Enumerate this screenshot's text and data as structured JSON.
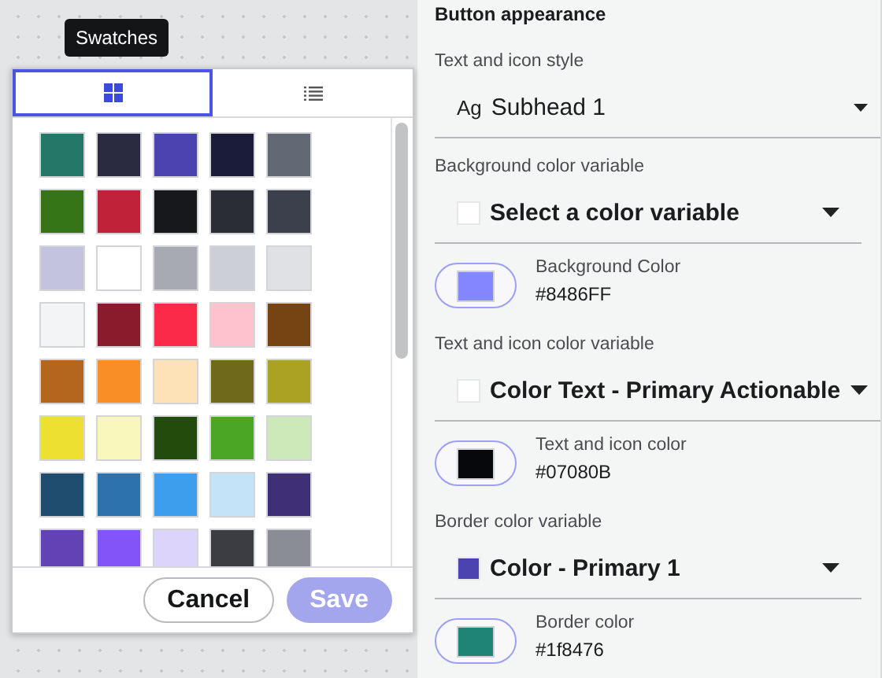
{
  "tooltip": "Swatches",
  "tabs": [
    {
      "kind": "grid",
      "selected": true
    },
    {
      "kind": "list",
      "selected": false
    }
  ],
  "swatches": [
    {
      "color": "#237868"
    },
    {
      "color": "#2a2a40"
    },
    {
      "color": "#4b44b0"
    },
    {
      "color": "#1b1b3a"
    },
    {
      "color": "#636875"
    },
    {
      "color": "#367517"
    },
    {
      "color": "#c0223a"
    },
    {
      "color": "#16181c"
    },
    {
      "color": "#2a2d35"
    },
    {
      "color": "#3c404c"
    },
    {
      "color": "#c3c3e0"
    },
    {
      "color": "#ffffff"
    },
    {
      "color": "#a7aab3"
    },
    {
      "color": "#cccfd6"
    },
    {
      "color": "#e0e1e5"
    },
    {
      "color": "#f3f4f6"
    },
    {
      "color": "#8a1b2c"
    },
    {
      "color": "#fb2a49"
    },
    {
      "color": "#fdc2cb"
    },
    {
      "color": "#764413"
    },
    {
      "color": "#b4661e"
    },
    {
      "color": "#f98e27"
    },
    {
      "color": "#fde1b7"
    },
    {
      "color": "#6e6a1a"
    },
    {
      "color": "#aba224"
    },
    {
      "color": "#ede030"
    },
    {
      "color": "#f9f7bc"
    },
    {
      "color": "#234b0c"
    },
    {
      "color": "#4aa623"
    },
    {
      "color": "#cde8b9"
    },
    {
      "color": "#1f4d70"
    },
    {
      "color": "#2e72ab"
    },
    {
      "color": "#3c9eec"
    },
    {
      "color": "#c5e3f8"
    },
    {
      "color": "#3f2f77"
    },
    {
      "color": "#6342b6"
    },
    {
      "color": "#8355f8"
    },
    {
      "color": "#ddd4fc"
    },
    {
      "color": "#3c3d42"
    },
    {
      "color": "#8b8d96"
    }
  ],
  "buttons": [
    {
      "label": "Cancel",
      "disabled": false
    },
    {
      "label": "Save",
      "disabled": true
    }
  ],
  "panel": {
    "title": "Button appearance",
    "fields": [
      {
        "kind": "style_select",
        "label": "Text and icon style",
        "prefix": "Ag",
        "value": "Subhead 1"
      },
      {
        "kind": "variable_select",
        "label": "Background color variable",
        "value": "Select a color variable",
        "color": "#ffffff"
      },
      {
        "kind": "color_readout",
        "label": "Background Color",
        "value": "#8486FF",
        "color": "#8486ff"
      },
      {
        "kind": "variable_select",
        "label": "Text and icon color variable",
        "value": "Color Text - Primary Actionable",
        "color": "#ffffff"
      },
      {
        "kind": "color_readout",
        "label": "Text and icon color",
        "value": "#07080B",
        "color": "#07080b"
      },
      {
        "kind": "variable_select",
        "label": "Border color variable",
        "value": "Color - Primary 1",
        "color": "#4b44b0"
      },
      {
        "kind": "color_readout",
        "label": "Border color",
        "value": "#1f8476",
        "color": "#1f8476"
      }
    ]
  }
}
